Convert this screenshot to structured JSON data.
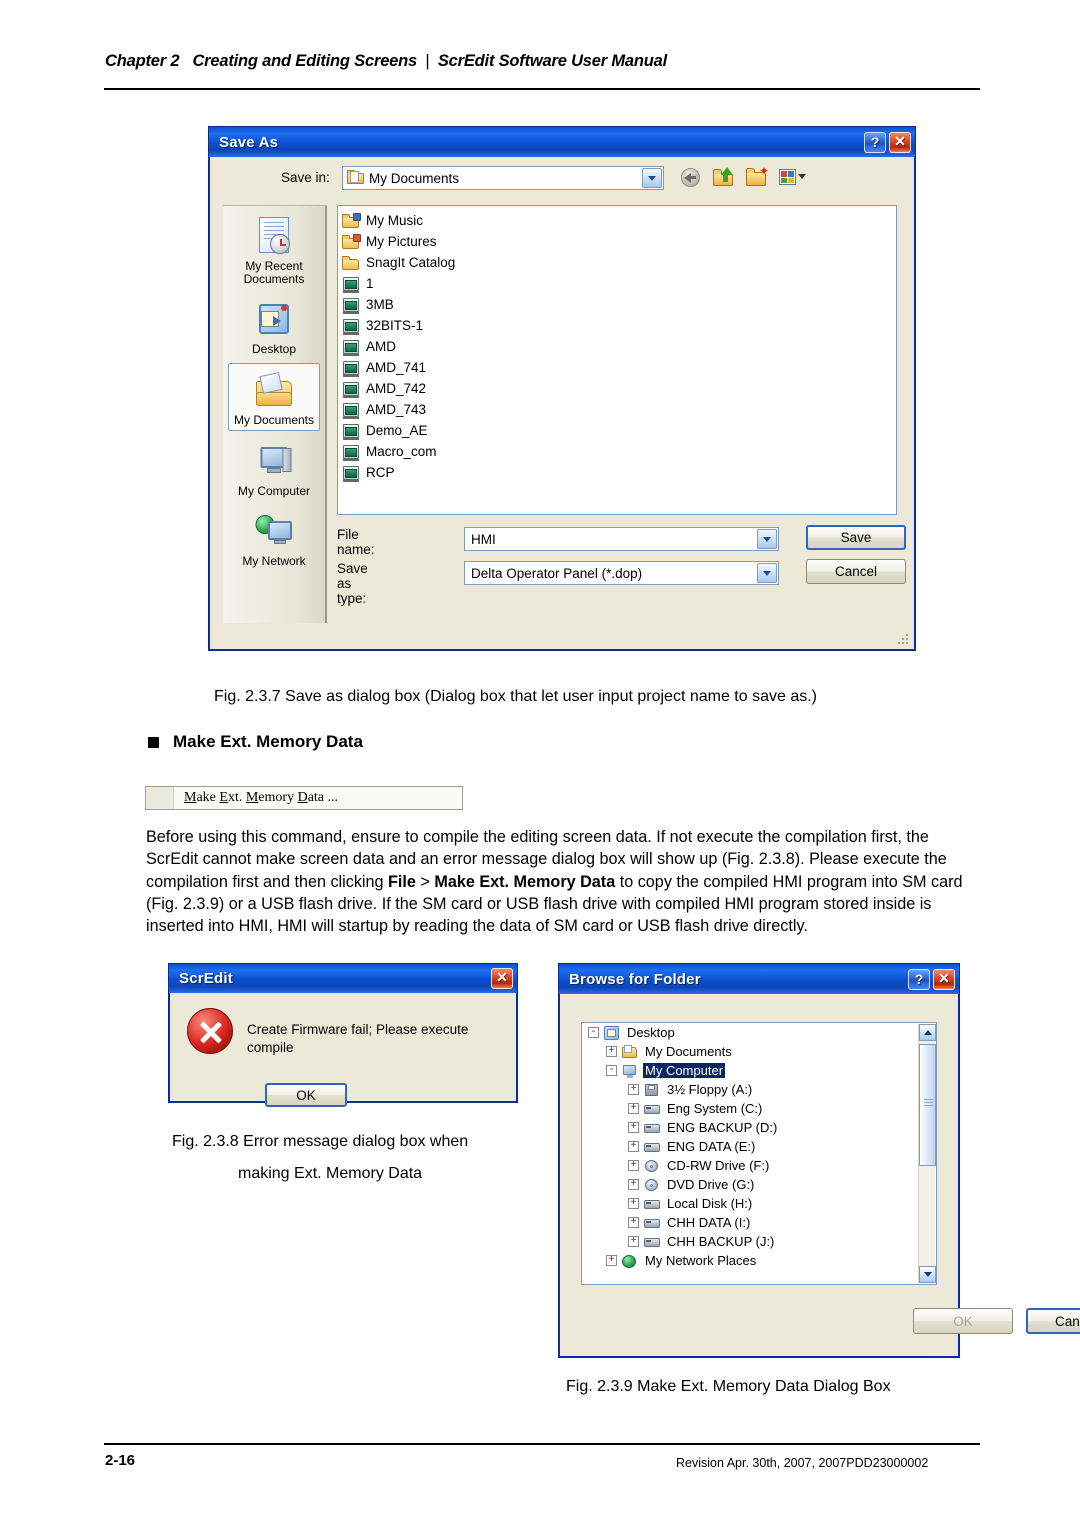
{
  "page": {
    "header_chapter": "Chapter 2",
    "header_title": "Creating and Editing Screens",
    "header_sep": "|",
    "header_manual": "ScrEdit Software User Manual",
    "page_number": "2-16",
    "revision": "Revision Apr. 30th, 2007, 2007PDD23000002"
  },
  "save_as": {
    "title": "Save As",
    "help_icon": "?",
    "close_icon": "✕",
    "save_in_label": "Save in:",
    "save_in_value": "My Documents",
    "toolbar_icons": [
      "back-icon",
      "up-one-level-icon",
      "new-folder-icon",
      "views-icon"
    ],
    "places": [
      {
        "label": "My Recent\nDocuments",
        "icon": "recent-documents-icon",
        "selected": false
      },
      {
        "label": "Desktop",
        "icon": "desktop-icon",
        "selected": false
      },
      {
        "label": "My Documents",
        "icon": "my-documents-icon",
        "selected": true
      },
      {
        "label": "My Computer",
        "icon": "my-computer-icon",
        "selected": false
      },
      {
        "label": "My Network",
        "icon": "my-network-icon",
        "selected": false
      }
    ],
    "files": [
      {
        "name": "My Music",
        "type": "folder-music"
      },
      {
        "name": "My Pictures",
        "type": "folder-pictures"
      },
      {
        "name": "SnagIt Catalog",
        "type": "folder"
      },
      {
        "name": "1",
        "type": "file"
      },
      {
        "name": "3MB",
        "type": "file"
      },
      {
        "name": "32BITS-1",
        "type": "file"
      },
      {
        "name": "AMD",
        "type": "file"
      },
      {
        "name": "AMD_741",
        "type": "file"
      },
      {
        "name": "AMD_742",
        "type": "file"
      },
      {
        "name": "AMD_743",
        "type": "file"
      },
      {
        "name": "Demo_AE",
        "type": "file"
      },
      {
        "name": "Macro_com",
        "type": "file"
      },
      {
        "name": "RCP",
        "type": "file"
      }
    ],
    "file_name_label": "File name:",
    "file_name_value": "HMI",
    "save_as_type_label": "Save as type:",
    "save_as_type_value": "Delta Operator Panel (*.dop)",
    "save_button": "Save",
    "cancel_button": "Cancel"
  },
  "fig237_caption": "Fig. 2.3.7 Save as dialog box (Dialog box that let user input project name to save as.)",
  "section": {
    "bullet_heading": "Make Ext. Memory Data",
    "menu_item": "Make Ext. Memory Data ..."
  },
  "body": {
    "p1_a": "Before using this command, ensure to compile the editing screen data. If not execute the compilation first, the ScrEdit cannot make screen data and an error message dialog box will show up (Fig. 2.3.8). Please execute the compilation first and then clicking ",
    "p1_b": "File",
    "p1_c": " > ",
    "p1_d": "Make Ext. Memory Data",
    "p1_e": " to copy the compiled HMI program into SM card (Fig. 2.3.9) or a USB flash drive. If the SM card or USB flash drive with compiled HMI program stored inside is inserted into HMI, HMI will startup by reading the data of SM card or USB flash drive directly."
  },
  "scredit_dialog": {
    "title": "ScrEdit",
    "close_icon": "✕",
    "icon": "error-icon",
    "message": "Create Firmware fail; Please execute compile",
    "ok_button": "OK"
  },
  "fig238_caption_line1": "Fig. 2.3.8 Error message dialog box when",
  "fig238_caption_line2": "making Ext. Memory Data",
  "browse_dialog": {
    "title": "Browse for Folder",
    "help_icon": "?",
    "close_icon": "✕",
    "tree": [
      {
        "label": "Desktop",
        "indent": 0,
        "expander": "-",
        "icon": "desktop-icon",
        "selected": false
      },
      {
        "label": "My Documents",
        "indent": 1,
        "expander": "+",
        "icon": "my-documents-icon",
        "selected": false
      },
      {
        "label": "My Computer",
        "indent": 1,
        "expander": "-",
        "icon": "my-computer-icon",
        "selected": true
      },
      {
        "label": "3½ Floppy (A:)",
        "indent": 2,
        "expander": "+",
        "icon": "floppy-icon",
        "selected": false
      },
      {
        "label": "Eng System (C:)",
        "indent": 2,
        "expander": "+",
        "icon": "hard-drive-icon",
        "selected": false
      },
      {
        "label": "ENG BACKUP (D:)",
        "indent": 2,
        "expander": "+",
        "icon": "hard-drive-icon",
        "selected": false
      },
      {
        "label": "ENG DATA (E:)",
        "indent": 2,
        "expander": "+",
        "icon": "hard-drive-icon",
        "selected": false
      },
      {
        "label": "CD-RW Drive (F:)",
        "indent": 2,
        "expander": "+",
        "icon": "cd-drive-icon",
        "selected": false
      },
      {
        "label": "DVD Drive (G:)",
        "indent": 2,
        "expander": "+",
        "icon": "cd-drive-icon",
        "selected": false
      },
      {
        "label": "Local Disk (H:)",
        "indent": 2,
        "expander": "+",
        "icon": "hard-drive-icon",
        "selected": false
      },
      {
        "label": "CHH DATA (I:)",
        "indent": 2,
        "expander": "+",
        "icon": "hard-drive-icon",
        "selected": false
      },
      {
        "label": "CHH BACKUP (J:)",
        "indent": 2,
        "expander": "+",
        "icon": "hard-drive-icon",
        "selected": false
      },
      {
        "label": "My Network Places",
        "indent": 1,
        "expander": "+",
        "icon": "network-icon",
        "selected": false
      }
    ],
    "ok_button": "OK",
    "ok_disabled": true,
    "cancel_button": "Cancel"
  },
  "fig239_caption": "Fig. 2.3.9 Make Ext. Memory Data Dialog Box",
  "colors": {
    "titlebar_blue": "#0a4fd0",
    "dialog_face": "#ece9d8",
    "selection_blue": "#0a246a",
    "close_red": "#d6411f"
  }
}
